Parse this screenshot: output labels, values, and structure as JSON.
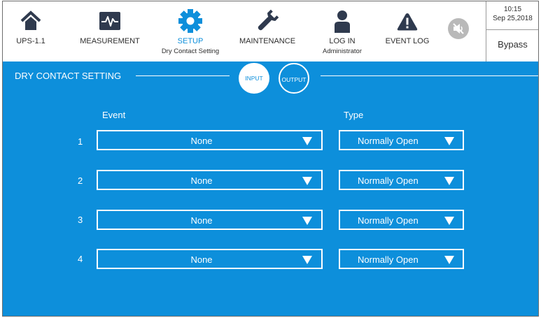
{
  "header": {
    "nav": [
      {
        "label": "UPS-1.1",
        "sub": "",
        "icon": "home-icon"
      },
      {
        "label": "MEASUREMENT",
        "sub": "",
        "icon": "waveform-icon"
      },
      {
        "label": "SETUP",
        "sub": "Dry Contact Setting",
        "icon": "gear-icon",
        "active": true
      },
      {
        "label": "MAINTENANCE",
        "sub": "",
        "icon": "wrench-icon"
      },
      {
        "label": "LOG IN",
        "sub": "Administrator",
        "icon": "user-icon"
      },
      {
        "label": "EVENT LOG",
        "sub": "",
        "icon": "warning-icon"
      }
    ],
    "mute_icon": "speaker-mute-icon",
    "time": "10:15",
    "date": "Sep 25,2018",
    "mode": "Bypass"
  },
  "panel": {
    "title": "DRY CONTACT SETTING",
    "tabs": [
      {
        "label": "INPUT",
        "active": true
      },
      {
        "label": "OUTPUT",
        "active": false
      }
    ],
    "event_header": "Event",
    "type_header": "Type",
    "rows": [
      {
        "num": "1",
        "event": "None",
        "type": "Normally Open"
      },
      {
        "num": "2",
        "event": "None",
        "type": "Normally Open"
      },
      {
        "num": "3",
        "event": "None",
        "type": "Normally Open"
      },
      {
        "num": "4",
        "event": "None",
        "type": "Normally Open"
      }
    ]
  },
  "colors": {
    "accent": "#0d8fdb",
    "icon": "#2f3a4e",
    "mute": "#b9b9b9"
  }
}
